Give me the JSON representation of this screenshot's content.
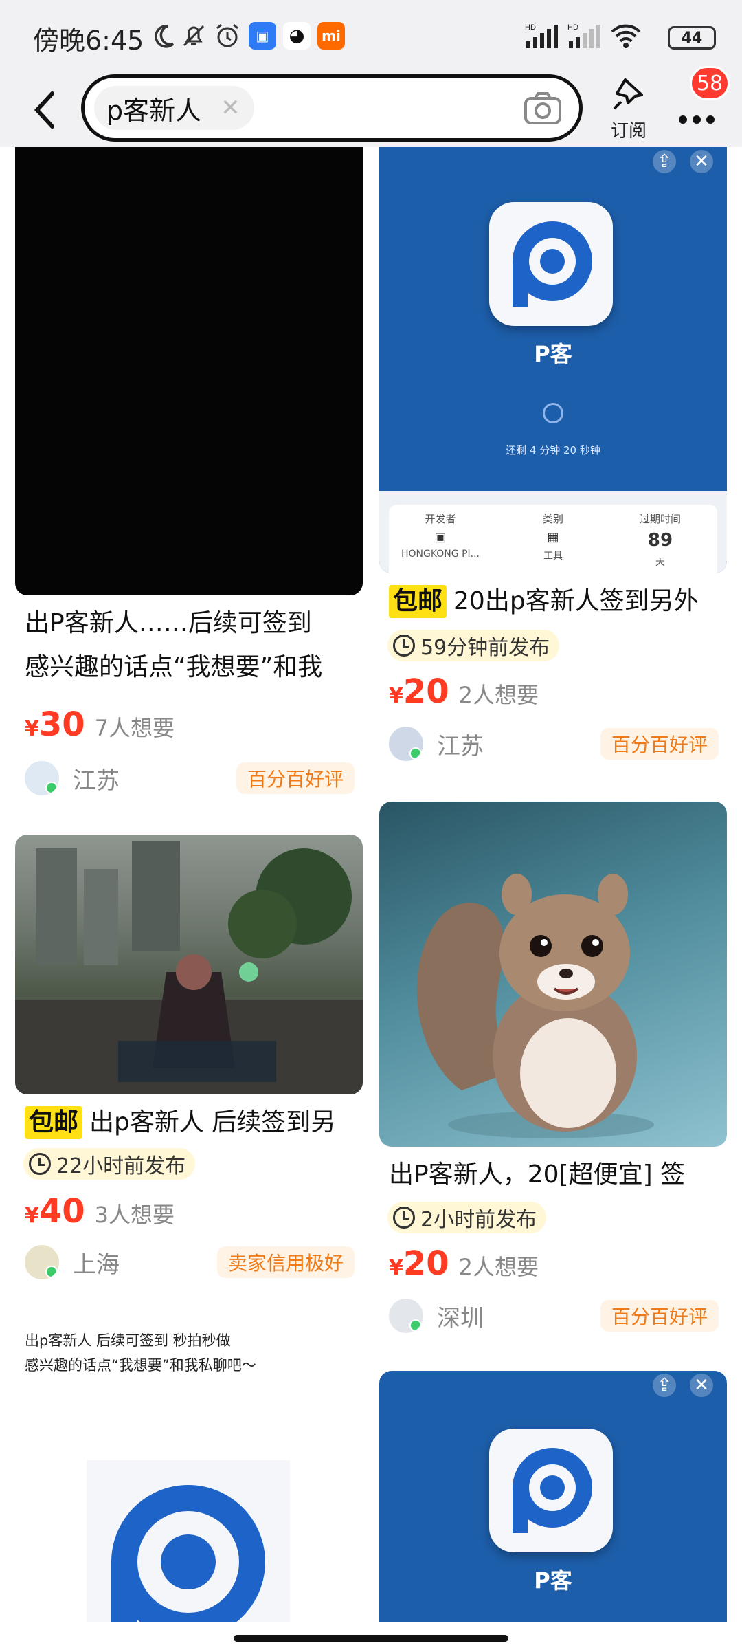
{
  "status_bar": {
    "time": "傍晚6:45",
    "battery": "44",
    "signal_label_1": "HD",
    "signal_label_2": "HD"
  },
  "header": {
    "search_chip": "p客新人",
    "subscribe_label": "订阅",
    "badge_count": "58"
  },
  "left_column": [
    {
      "title": "出P客新人……后续可签到",
      "title_line2": "感兴趣的话点“我想要”和我",
      "price": "30",
      "currency": "¥",
      "want": "7人想要",
      "city": "江苏",
      "tag": "百分百好评"
    },
    {
      "badge": "包邮",
      "title": "出p客新人 后续签到另",
      "time": "22小时前发布",
      "price": "40",
      "currency": "¥",
      "want": "3人想要",
      "city": "上海",
      "tag": "卖家信用极好"
    },
    {
      "text_line1": "出p客新人  后续可签到  秒拍秒做",
      "text_line2": "感兴趣的话点“我想要”和我私聊吧～"
    }
  ],
  "right_column": [
    {
      "image_label": "P客",
      "image_countdown": "还剩 4 分钟 20 秒钟",
      "info": [
        {
          "key": "开发者",
          "value": "HONGKONG PI..."
        },
        {
          "key": "类别",
          "value": "工具"
        },
        {
          "key": "过期时间",
          "value": "89",
          "sub": "天"
        }
      ],
      "badge": "包邮",
      "title": "20出p客新人签到另外",
      "time": "59分钟前发布",
      "price": "20",
      "currency": "¥",
      "want": "2人想要",
      "city": "江苏",
      "tag": "百分百好评"
    },
    {
      "title": "出P客新人，20[超便宜] 签",
      "time": "2小时前发布",
      "price": "20",
      "currency": "¥",
      "want": "2人想要",
      "city": "深圳",
      "tag": "百分百好评"
    },
    {
      "image_label": "P客"
    }
  ],
  "colors": {
    "accent_price": "#ff3b23",
    "tag_orange": "#f07a18",
    "baoyou_yellow": "#ffe014",
    "badge_red": "#ff3b30",
    "app_blue": "#1d5eaa"
  }
}
